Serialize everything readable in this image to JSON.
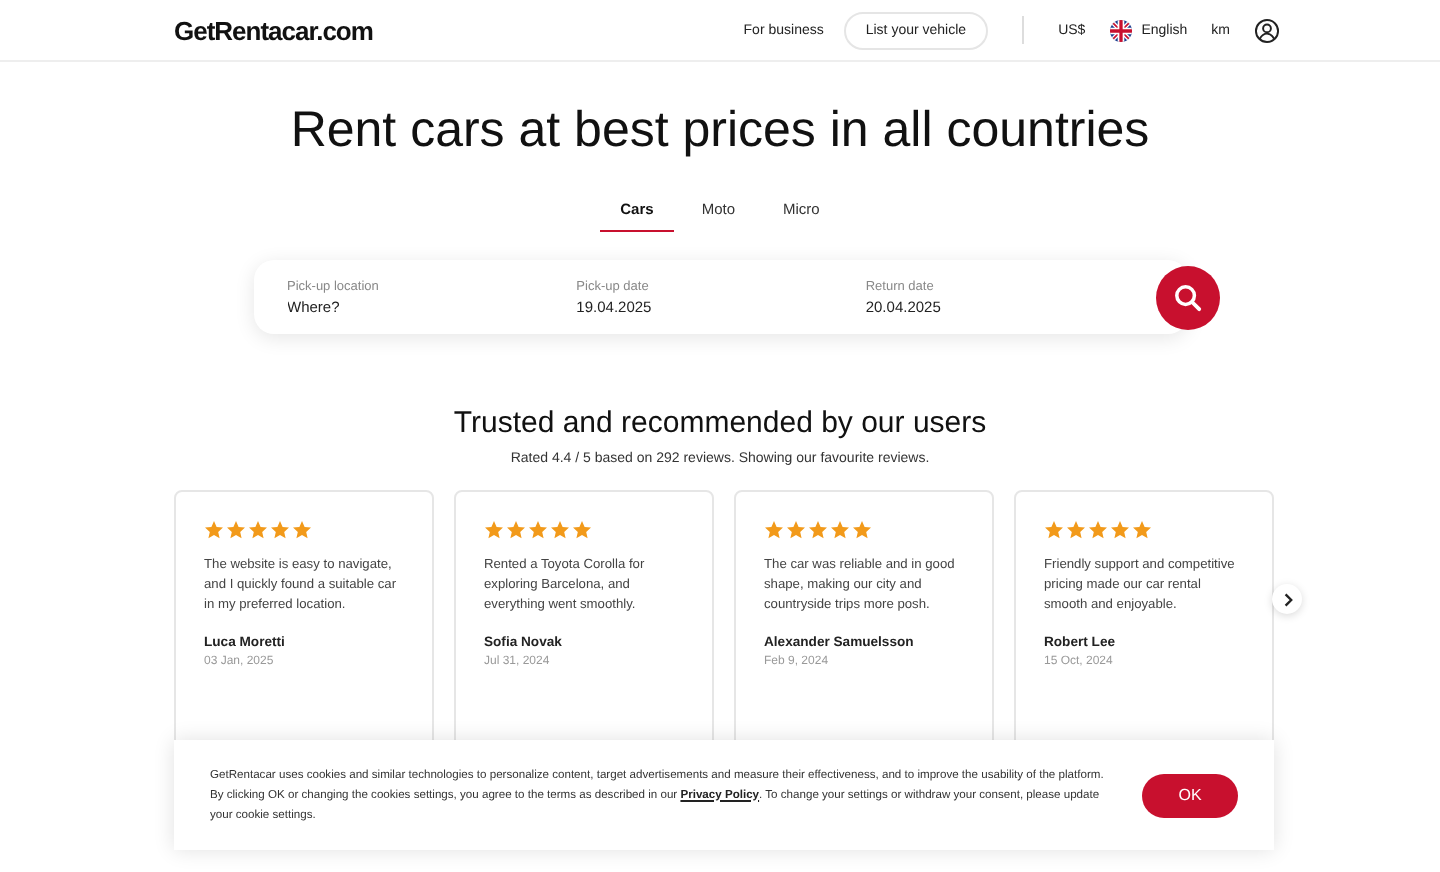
{
  "header": {
    "logo": "GetRentacar.com",
    "links": [
      {
        "label": "For business",
        "kind": "link"
      },
      {
        "label": "List your vehicle",
        "kind": "outlined"
      }
    ],
    "currency": "US$",
    "language": "English",
    "units": "km"
  },
  "hero": {
    "title": "Rent cars at best prices in all countries"
  },
  "tabs": [
    {
      "label": "Cars",
      "selected": true
    },
    {
      "label": "Moto",
      "selected": false
    },
    {
      "label": "Micro",
      "selected": false
    }
  ],
  "search": {
    "fields": [
      {
        "label": "Pick-up location",
        "placeholder": "Where?"
      },
      {
        "label": "Pick-up date",
        "value": "19.04.2025"
      },
      {
        "label": "Return date",
        "value": "20.04.2025"
      }
    ]
  },
  "reviews": {
    "title": "Trusted and recommended by our users",
    "subtitle": "Rated 4.4 / 5 based on 292 reviews. Showing our favourite reviews.",
    "items": [
      {
        "stars": 5,
        "text": "The website is easy to navigate, and I quickly found a suitable car in my preferred location.",
        "name": "Luca Moretti",
        "date": "03 Jan, 2025"
      },
      {
        "stars": 5,
        "text": "Rented a Toyota Corolla for exploring Barcelona, and everything went smoothly.",
        "name": "Sofia Novak",
        "date": "Jul 31, 2024"
      },
      {
        "stars": 5,
        "text": "The car was reliable and in good shape, making our city and countryside trips more posh.",
        "name": "Alexander Samuelsson",
        "date": "Feb 9, 2024"
      },
      {
        "stars": 5,
        "text": "Friendly support and competitive pricing made our car rental smooth and enjoyable.",
        "name": "Robert Lee",
        "date": "15 Oct, 2024"
      }
    ]
  },
  "cookie_banner": {
    "text_before": "GetRentacar uses cookies and similar technologies to personalize content, target advertisements and measure their effectiveness, and to improve the usability of the platform. By clicking OK or changing the cookies settings, you agree to the terms as described in our",
    "link": "Privacy Policy",
    "text_after": ". To change your settings or withdraw your consent, please update your cookie settings.",
    "button": "OK"
  }
}
